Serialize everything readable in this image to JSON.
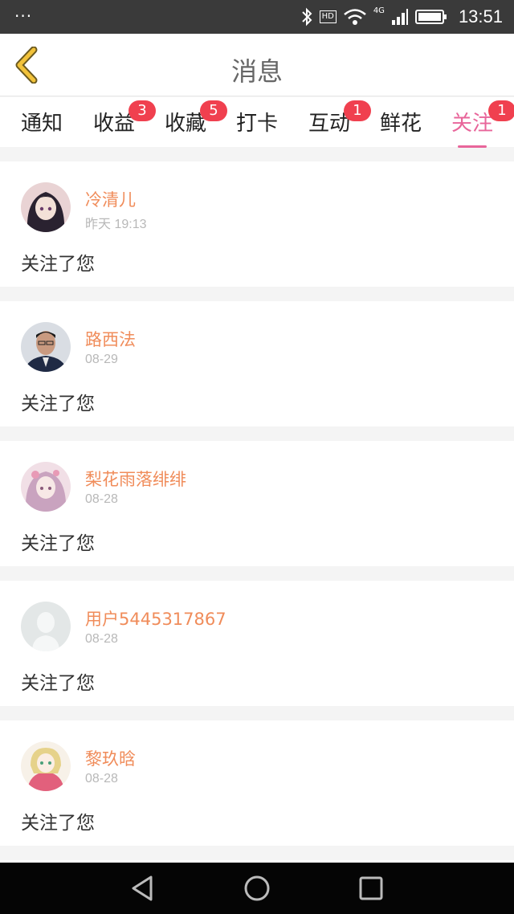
{
  "status_bar": {
    "time": "13:51",
    "hd": "HD",
    "network": "4G",
    "dots": "···"
  },
  "header": {
    "title": "消息"
  },
  "tabs": [
    {
      "label": "通知"
    },
    {
      "label": "收益",
      "badge": "3"
    },
    {
      "label": "收藏",
      "badge": "5"
    },
    {
      "label": "打卡"
    },
    {
      "label": "互动",
      "badge": "1"
    },
    {
      "label": "鲜花"
    },
    {
      "label": "关注",
      "badge": "1",
      "active": true
    }
  ],
  "messages": [
    {
      "name": "冷清儿",
      "time": "昨天 19:13",
      "text": "关注了您"
    },
    {
      "name": "路西法",
      "time": "08-29",
      "text": "关注了您"
    },
    {
      "name": "梨花雨落绯绯",
      "time": "08-28",
      "text": "关注了您"
    },
    {
      "name": "用户5445317867",
      "time": "08-28",
      "text": "关注了您"
    },
    {
      "name": "黎玖晗",
      "time": "08-28",
      "text": "关注了您"
    }
  ],
  "colors": {
    "accent": "#e8659a",
    "name": "#f08c5a",
    "badge": "#f0404f",
    "back_arrow": "#f2c23a"
  }
}
